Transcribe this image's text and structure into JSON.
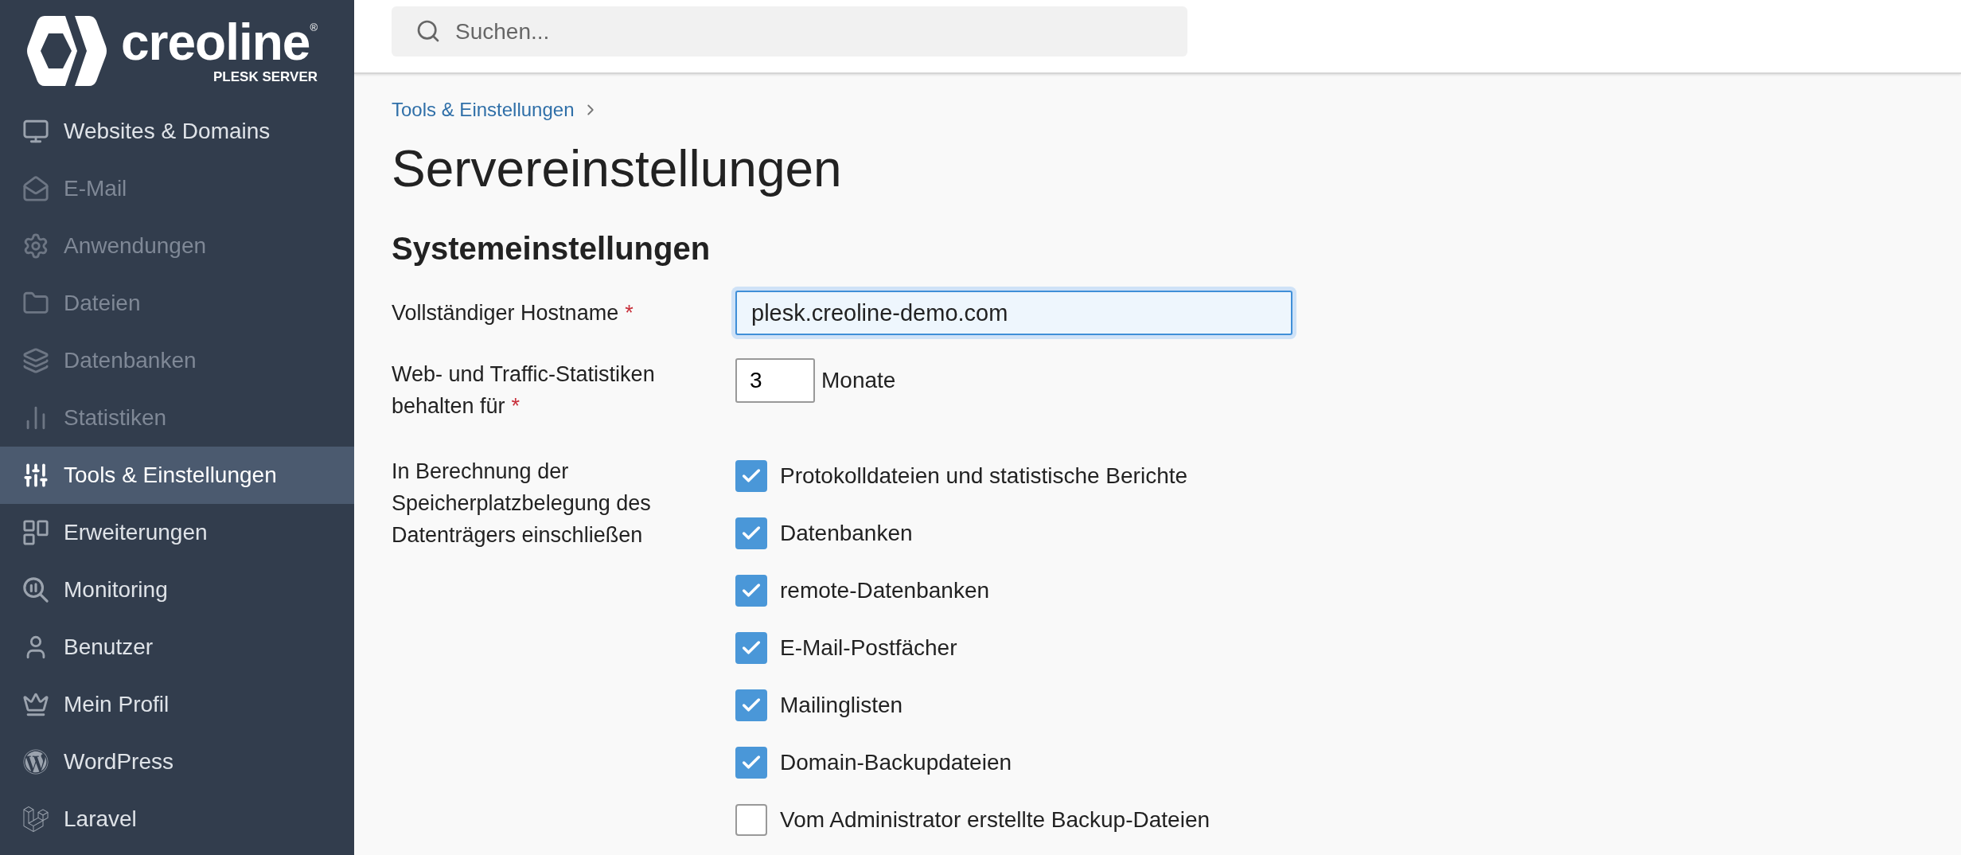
{
  "logo": {
    "name": "creoline",
    "registered": "®",
    "subtitle": "PLESK SERVER"
  },
  "sidebar": {
    "items": [
      {
        "label": "Websites & Domains",
        "selected": false,
        "disabled": false
      },
      {
        "label": "E-Mail",
        "selected": false,
        "disabled": true
      },
      {
        "label": "Anwendungen",
        "selected": false,
        "disabled": true
      },
      {
        "label": "Dateien",
        "selected": false,
        "disabled": true
      },
      {
        "label": "Datenbanken",
        "selected": false,
        "disabled": true
      },
      {
        "label": "Statistiken",
        "selected": false,
        "disabled": true
      },
      {
        "label": "Tools & Einstellungen",
        "selected": true,
        "disabled": false
      },
      {
        "label": "Erweiterungen",
        "selected": false,
        "disabled": false
      },
      {
        "label": "Monitoring",
        "selected": false,
        "disabled": false
      },
      {
        "label": "Benutzer",
        "selected": false,
        "disabled": false
      },
      {
        "label": "Mein Profil",
        "selected": false,
        "disabled": false
      },
      {
        "label": "WordPress",
        "selected": false,
        "disabled": false
      },
      {
        "label": "Laravel",
        "selected": false,
        "disabled": false
      }
    ]
  },
  "search": {
    "placeholder": "Suchen..."
  },
  "breadcrumb": [
    "Tools & Einstellungen"
  ],
  "title": "Servereinstellungen",
  "section": {
    "title": "Systemeinstellungen",
    "hostname": {
      "label": "Vollständiger Hostname",
      "required_mark": "*",
      "value": "plesk.creoline-demo.com",
      "focused": true
    },
    "retention": {
      "label": "Web- und Traffic-Statistiken behalten für",
      "required_mark": "*",
      "value": "3",
      "unit": "Monate"
    },
    "disk_usage": {
      "label": "In Berechnung der Speicherplatzbelegung des Datenträgers einschließen",
      "options": [
        {
          "label": "Protokolldateien und statistische Berichte",
          "checked": true
        },
        {
          "label": "Datenbanken",
          "checked": true
        },
        {
          "label": "remote-Datenbanken",
          "checked": true
        },
        {
          "label": "E-Mail-Postfächer",
          "checked": true
        },
        {
          "label": "Mailinglisten",
          "checked": true
        },
        {
          "label": "Domain-Backupdateien",
          "checked": true
        },
        {
          "label": "Vom Administrator erstellte Backup-Dateien",
          "checked": false
        }
      ]
    }
  }
}
